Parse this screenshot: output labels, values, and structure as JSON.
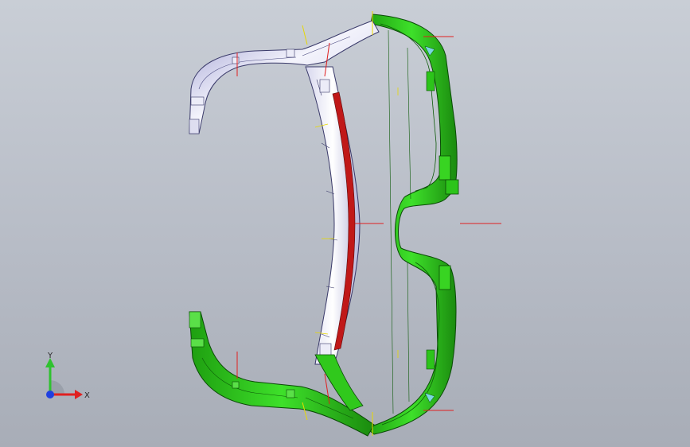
{
  "viewport": {
    "background_top": "#c9ced6",
    "background_bottom": "#a8adb7"
  },
  "triad": {
    "x_label": "X",
    "y_label": "Y",
    "x_color": "#e02020",
    "y_color": "#2fc22f",
    "z_color": "#2040e0"
  },
  "model": {
    "selected_color": "#2ecb1a",
    "unselected_color": "#e6e6f4",
    "highlight_color": "#c01818",
    "annotation_red": "#e02020",
    "annotation_yellow": "#e8d800"
  }
}
